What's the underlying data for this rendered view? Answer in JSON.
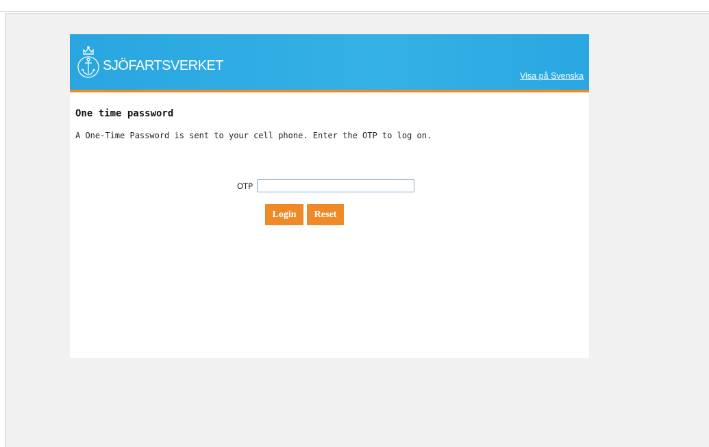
{
  "header": {
    "brand": "SJÖFARTSVERKET",
    "language_link": "Visa på Svenska"
  },
  "main": {
    "title": "One time password",
    "instruction": "A One-Time Password is sent to your cell phone. Enter the OTP to log on.",
    "otp_label": "OTP",
    "otp_value": "",
    "login_label": "Login",
    "reset_label": "Reset"
  },
  "colors": {
    "banner_blue": "#2aa7e1",
    "accent_orange": "#ee8a27",
    "page_background": "#f1f1f1"
  },
  "icons": {
    "logo": "anchor-crown-emblem-icon"
  }
}
